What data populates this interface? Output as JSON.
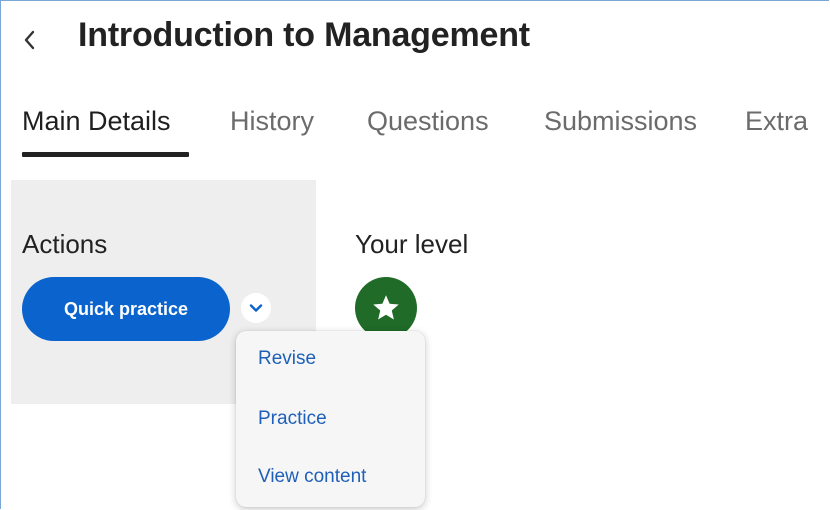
{
  "header": {
    "title": "Introduction to Management",
    "back_icon": "chevron-left-icon"
  },
  "tabs": [
    {
      "label": "Main Details",
      "active": true
    },
    {
      "label": "History",
      "active": false
    },
    {
      "label": "Questions",
      "active": false
    },
    {
      "label": "Submissions",
      "active": false
    },
    {
      "label": "Extra",
      "active": false
    }
  ],
  "actions": {
    "title": "Actions",
    "primary_label": "Quick practice",
    "toggle_icon": "chevron-down-icon",
    "menu": [
      {
        "label": "Revise"
      },
      {
        "label": "Practice"
      },
      {
        "label": "View content"
      }
    ]
  },
  "level": {
    "title": "Your level",
    "badge_icon": "star-icon"
  },
  "colors": {
    "accent": "#0b63ce",
    "link": "#1e5fb8",
    "badge": "#1f6b27",
    "panel": "#eeeeee"
  }
}
